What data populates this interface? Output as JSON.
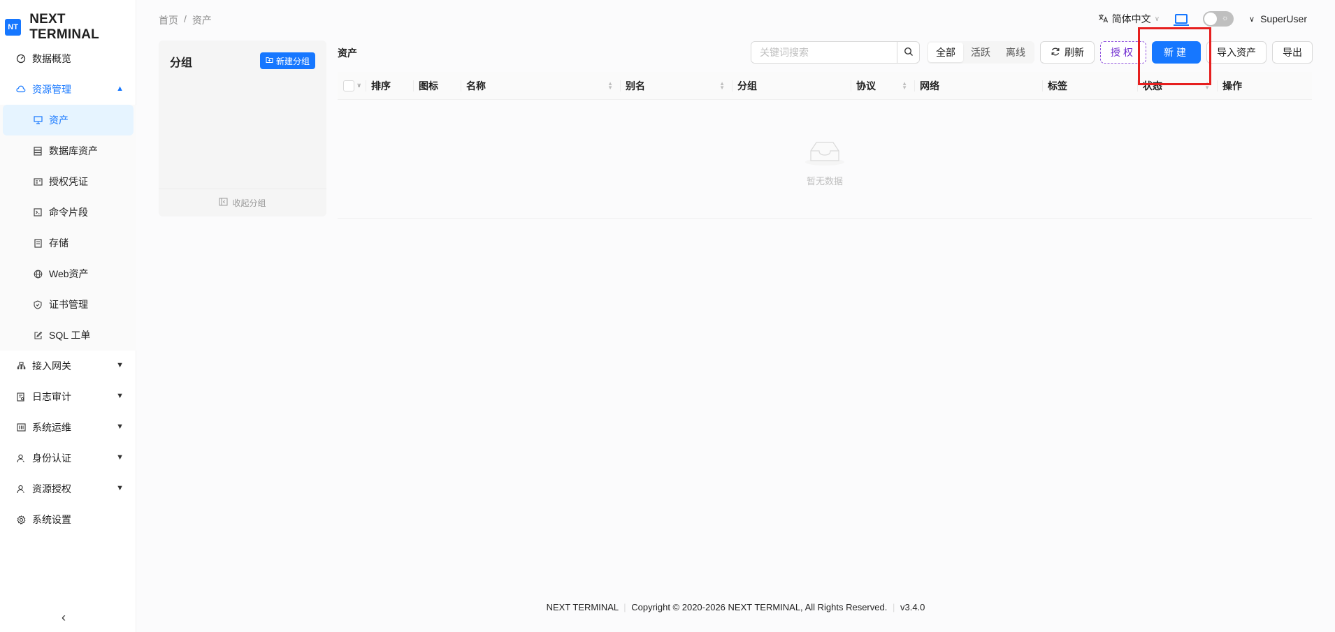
{
  "app": {
    "logo_badge": "NT",
    "logo_text": "NEXT TERMINAL"
  },
  "sidebar": {
    "items": [
      {
        "label": "数据概览",
        "icon": "dashboard-icon"
      },
      {
        "label": "资源管理",
        "icon": "cloud-icon",
        "open": true
      },
      {
        "label": "接入网关",
        "icon": "gateway-icon"
      },
      {
        "label": "日志审计",
        "icon": "audit-icon"
      },
      {
        "label": "系统运维",
        "icon": "ops-icon"
      },
      {
        "label": "身份认证",
        "icon": "user-icon"
      },
      {
        "label": "资源授权",
        "icon": "user-icon"
      },
      {
        "label": "系统设置",
        "icon": "gear-icon"
      }
    ],
    "sub_items": [
      {
        "label": "资产",
        "icon": "monitor-icon",
        "active": true
      },
      {
        "label": "数据库资产",
        "icon": "database-icon"
      },
      {
        "label": "授权凭证",
        "icon": "credential-icon"
      },
      {
        "label": "命令片段",
        "icon": "terminal-icon"
      },
      {
        "label": "存储",
        "icon": "storage-icon"
      },
      {
        "label": "Web资产",
        "icon": "globe-icon"
      },
      {
        "label": "证书管理",
        "icon": "shield-icon"
      },
      {
        "label": "SQL 工单",
        "icon": "edit-icon"
      }
    ]
  },
  "header": {
    "breadcrumb": [
      "首页",
      "/",
      "资产"
    ],
    "language": "简体中文",
    "user": "SuperUser"
  },
  "groups": {
    "title": "分组",
    "new_button": "新建分组",
    "collapse_label": "收起分组"
  },
  "assets": {
    "title": "资产",
    "search_placeholder": "关键词搜索",
    "filters": [
      "全部",
      "活跃",
      "离线"
    ],
    "selected_filter": "全部",
    "buttons": {
      "refresh": "刷新",
      "authorize": "授权",
      "new": "新建",
      "import": "导入资产",
      "export": "导出"
    },
    "columns": [
      "排序",
      "图标",
      "名称",
      "别名",
      "分组",
      "协议",
      "网络",
      "标签",
      "状态",
      "操作"
    ],
    "empty_text": "暂无数据"
  },
  "footer": {
    "brand": "NEXT TERMINAL",
    "copyright": "Copyright © 2020-2026 NEXT TERMINAL, All Rights Reserved.",
    "version": "v3.4.0"
  },
  "colors": {
    "primary": "#1677ff",
    "highlight": "#e61f1f",
    "authorize": "#722ed1"
  }
}
